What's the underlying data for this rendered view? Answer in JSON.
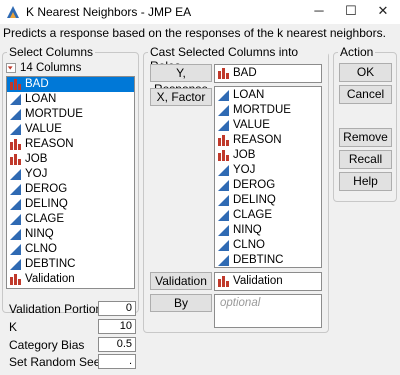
{
  "window": {
    "title": "K Nearest Neighbors - JMP EA",
    "minimize_glyph": "─",
    "maximize_glyph": "☐",
    "close_glyph": "✕",
    "description": "Predicts a response based on the responses of the k nearest neighbors."
  },
  "select_columns": {
    "title": "Select Columns",
    "count_label": "14 Columns",
    "items": [
      {
        "label": "BAD",
        "icon": "nominal-icon"
      },
      {
        "label": "LOAN",
        "icon": "continuous-icon"
      },
      {
        "label": "MORTDUE",
        "icon": "continuous-icon"
      },
      {
        "label": "VALUE",
        "icon": "continuous-icon"
      },
      {
        "label": "REASON",
        "icon": "nominal-icon"
      },
      {
        "label": "JOB",
        "icon": "nominal-icon"
      },
      {
        "label": "YOJ",
        "icon": "continuous-icon"
      },
      {
        "label": "DEROG",
        "icon": "continuous-icon"
      },
      {
        "label": "DELINQ",
        "icon": "continuous-icon"
      },
      {
        "label": "CLAGE",
        "icon": "continuous-icon"
      },
      {
        "label": "NINQ",
        "icon": "continuous-icon"
      },
      {
        "label": "CLNO",
        "icon": "continuous-icon"
      },
      {
        "label": "DEBTINC",
        "icon": "continuous-icon"
      },
      {
        "label": "Validation",
        "icon": "nominal-icon"
      }
    ],
    "selected": "BAD"
  },
  "cast_roles": {
    "title": "Cast Selected Columns into Roles",
    "y_response_button": "Y, Response",
    "y_response_value": "BAD",
    "x_factor_button": "X, Factor",
    "x_factor_items": [
      "LOAN",
      "MORTDUE",
      "VALUE",
      "REASON",
      "JOB",
      "YOJ",
      "DEROG",
      "DELINQ",
      "CLAGE",
      "NINQ",
      "CLNO",
      "DEBTINC"
    ],
    "validation_button": "Validation",
    "validation_value": "Validation",
    "by_button": "By",
    "by_placeholder": "optional"
  },
  "action": {
    "title": "Action",
    "ok": "OK",
    "cancel": "Cancel",
    "remove": "Remove",
    "recall": "Recall",
    "help": "Help"
  },
  "params": {
    "validation_portion_label": "Validation Portion",
    "validation_portion_value": "0",
    "k_label": "K",
    "k_value": "10",
    "category_bias_label": "Category Bias",
    "category_bias_value": "0.5",
    "seed_label": "Set Random Seed",
    "seed_value": "."
  },
  "colors": {
    "selection": "#0078d7",
    "nominal_icon": "#c0392b",
    "continuous_icon": "#2f6ab3"
  }
}
